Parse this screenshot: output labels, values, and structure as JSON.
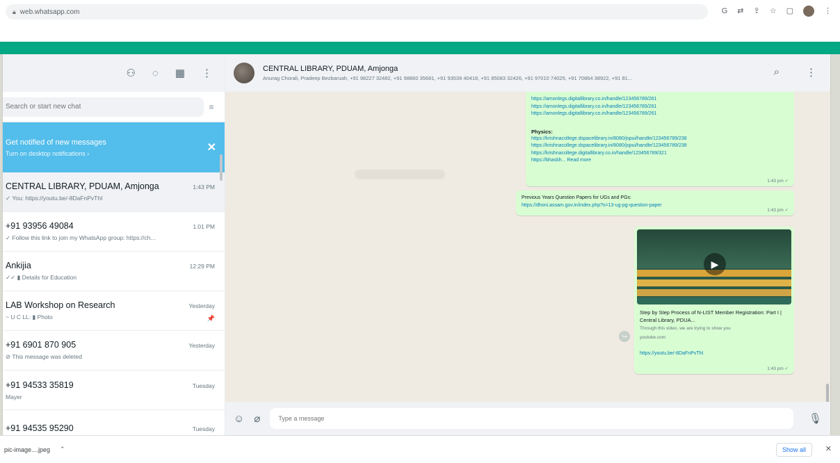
{
  "browser": {
    "url": "web.whatsapp.com",
    "icons": [
      "google-icon",
      "translate-icon",
      "share-icon",
      "star-icon",
      "sidebar-icon",
      "profile-avatar",
      "menu-icon"
    ]
  },
  "sidebar": {
    "search_placeholder": "Search or start new chat",
    "notification": {
      "title": "Get notified of new messages",
      "subtitle": "Turn on desktop notifications ›"
    },
    "chats": [
      {
        "name": "CENTRAL LIBRARY, PDUAM, Amjonga",
        "time": "1:43 PM",
        "preview": "✓ You: https://youtu.be/-8DaFnPvThI"
      },
      {
        "name": "+91 93956 49084",
        "time": "1:01 PM",
        "preview": "✓ Follow this link to join my WhatsApp group: https://ch..."
      },
      {
        "name": "Ankijia",
        "time": "12:29 PM",
        "preview": "✓✓ ▮ Details for Education"
      },
      {
        "name": "LAB Workshop on Research",
        "time": "Yesterday",
        "preview": "~ U C LL: ▮ Photo",
        "pin": "📌"
      },
      {
        "name": "+91 6901 870 905",
        "time": "Yesterday",
        "preview": "⊘ This message was deleted"
      },
      {
        "name": "+91 94533 35819",
        "time": "Tuesday",
        "preview": "Mayer"
      },
      {
        "name": "+91 94535 95290",
        "time": "Tuesday",
        "preview": ""
      }
    ]
  },
  "conversation": {
    "title": "CENTRAL LIBRARY, PDUAM, Amjonga",
    "members": "Anurag Chorali, Pradeep Bezbaruah, +91 98227 32482, +91 98860 35681, +91 93539 40418, +91 85083 32426, +91 97010 74025, +91 70864 38922, +91 81...",
    "msg1_links": [
      "https://amonlegs.digitallibrary.co.in/handle/123456789/261",
      "https://amonlegs.digitallibrary.co.in/handle/123456789/261",
      "https://amonlegs.digitallibrary.co.in/handle/123456789/261"
    ],
    "msg1_heading": "Physics:",
    "msg1_physics_links": [
      "https://krishnacollege.dspacelibrary.in/8080/jspui/handle/123456789/238",
      "https://krishnacollege.dspacelibrary.in/8080/jspui/handle/123456789/238",
      "https://krishnacollege.digitallibrary.co.in/handle/123456789/321"
    ],
    "msg1_readmore_prefix": "https://bhaskh... ",
    "msg1_readmore": "Read more",
    "msg1_time": "1:43 pm ✓",
    "msg2_title": "Previous Years Question Papers for UGs and PGs:",
    "msg2_link": "https://dhoni.assam.gov.in/index.php?s=13-ug-pg-question-paper",
    "msg2_time": "1:43 pm ✓",
    "video_title": "Step by Step Process of N-LIST Member Registration: Part I | Central Library, PDUA...",
    "video_desc": "Through this video, we are trying to show you",
    "video_source": "youtube.com",
    "video_link": "https://youtu.be/-8DaFnPvThI",
    "video_time": "1:43 pm ✓"
  },
  "composer": {
    "placeholder": "Type a message"
  },
  "download_bar": {
    "file": "pic-image....jpeg",
    "show_all": "Show all"
  },
  "colors": {
    "brand": "#00a884",
    "notification": "#53bdeb",
    "outgoing_bubble": "#d9fdd3",
    "chat_bg": "#efeae2"
  }
}
